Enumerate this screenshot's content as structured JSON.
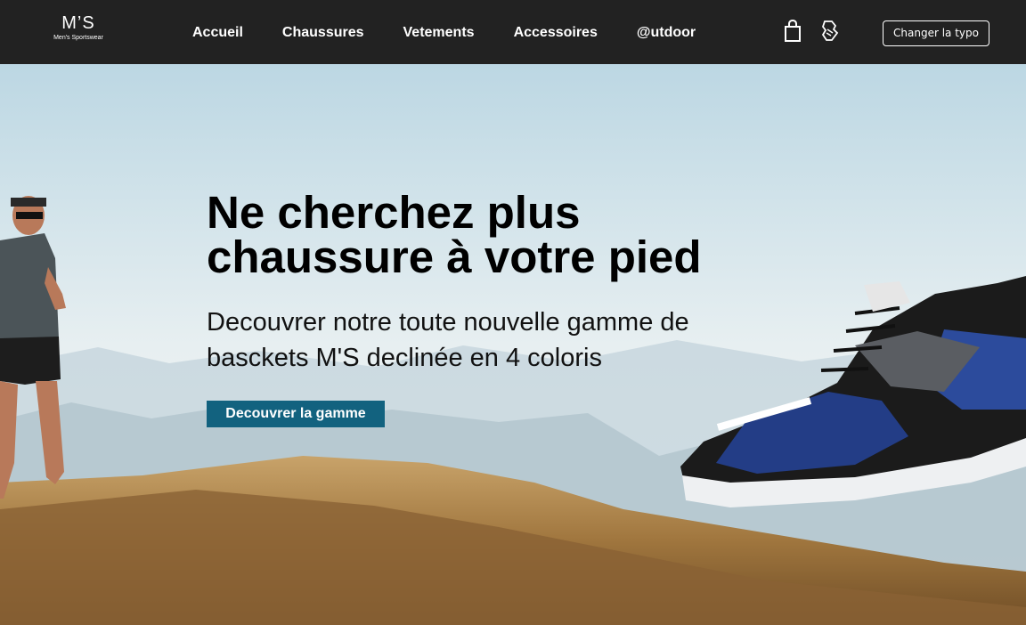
{
  "navbar": {
    "logo_mark": "M’S",
    "logo_sub": "Men's Sportswear",
    "links": [
      "Accueil",
      "Chaussures",
      "Vetements",
      "Accessoires",
      "@utdoor"
    ],
    "icons": [
      "shopping-bag-icon",
      "running-shoe-icon"
    ],
    "typo_button": "Changer la typo"
  },
  "hero": {
    "title": "Ne cherchez plus chaussure à votre pied",
    "subtitle": "Decouvrer notre toute nouvelle gamme de basckets M'S declinée en 4 coloris",
    "cta": "Decouvrer la gamme"
  },
  "colors": {
    "navbar_bg": "#222222",
    "cta_bg": "#12627f",
    "text": "#000000"
  }
}
